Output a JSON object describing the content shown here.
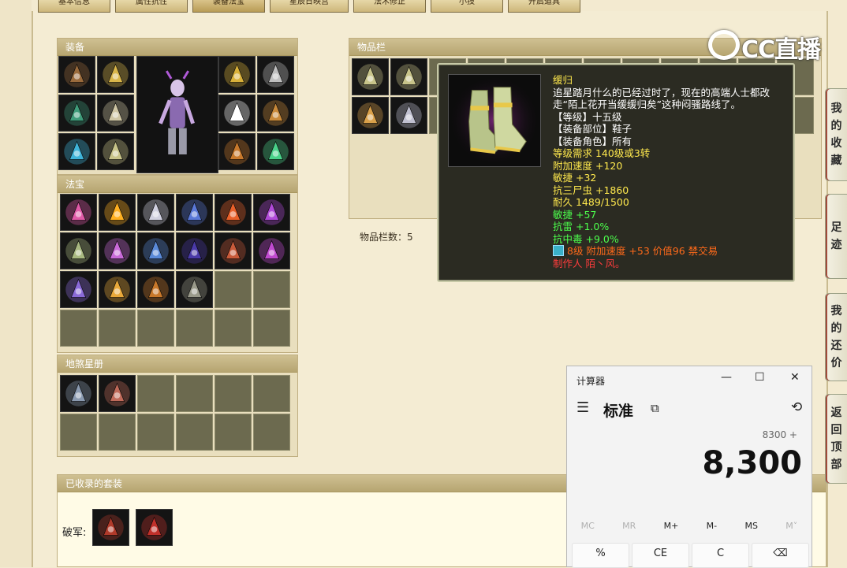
{
  "tabs": [
    "基本信息",
    "属性抗性",
    "装备法宝",
    "星辰日映宫",
    "法术修正",
    "小技",
    "开启道具"
  ],
  "equipment": {
    "title": "装备",
    "left_items": [
      {
        "icon": "hair-icon",
        "color": "#9a6b3c"
      },
      {
        "icon": "necklace-icon",
        "color": "#d9b64a"
      },
      {
        "icon": "spear-icon",
        "color": "#3f9c7a"
      },
      {
        "icon": "armor-icon",
        "color": "#cfc6a4"
      },
      {
        "icon": "charm-icon",
        "color": "#3fb4d9"
      },
      {
        "icon": "boots-icon",
        "color": "#c8c48a"
      }
    ],
    "right_items": [
      {
        "icon": "mask-icon",
        "color": "#d9b13a"
      },
      {
        "icon": "bead-necklace-icon",
        "color": "#bfbfbf"
      },
      {
        "icon": "helmet-icon",
        "color": "#ffffff"
      },
      {
        "icon": "ring-icon",
        "color": "#c98a3a"
      },
      {
        "icon": "ring-icon",
        "color": "#c8792c"
      },
      {
        "icon": "orb-icon",
        "color": "#4ad28a"
      }
    ]
  },
  "treasure": {
    "title": "法宝",
    "items": [
      {
        "icon": "lantern-icon",
        "color": "#e05aa8"
      },
      {
        "icon": "flame-icon",
        "color": "#ffb020"
      },
      {
        "icon": "mirror-icon",
        "color": "#d0d0e0"
      },
      {
        "icon": "gauntlet-icon",
        "color": "#5a78d8"
      },
      {
        "icon": "sword-icon",
        "color": "#e8602a"
      },
      {
        "icon": "claw-icon",
        "color": "#b04ad8"
      },
      {
        "icon": "jade-icon",
        "color": "#a8b880"
      },
      {
        "icon": "staff-icon",
        "color": "#c86ad8"
      },
      {
        "icon": "bracer-icon",
        "color": "#5a8ad8"
      },
      {
        "icon": "vortex-icon",
        "color": "#4a3aa8"
      },
      {
        "icon": "bell-icon",
        "color": "#c85a3a"
      },
      {
        "icon": "whip-icon",
        "color": "#c04ad0"
      },
      {
        "icon": "scroll-icon",
        "color": "#8a6ad8"
      },
      {
        "icon": "tower-icon",
        "color": "#e8a83a"
      },
      {
        "icon": "pipa-icon",
        "color": "#c8782a"
      },
      {
        "icon": "fan-icon",
        "color": "#9a9a8a"
      }
    ]
  },
  "stars": {
    "title": "地煞星册",
    "items": [
      {
        "icon": "card-warrior-icon",
        "color": "#8a9ab0"
      },
      {
        "icon": "card-warrior-icon",
        "color": "#c06a5a"
      }
    ]
  },
  "inventory": {
    "title": "物品栏",
    "count_label": "物品栏数：5",
    "items": [
      {
        "icon": "boots-icon",
        "color": "#c8c48a"
      },
      {
        "icon": "boots-icon",
        "color": "#c8c48a"
      },
      {
        "icon": "amulet-icon",
        "color": "#d9a04a"
      },
      {
        "icon": "tablet-icon",
        "color": "#c0c0d0"
      }
    ]
  },
  "tooltip": {
    "name": "缓归",
    "desc": "追星踏月什么的已经过时了，现在的高端人士都改走“陌上花开当缓缓归矣”这种闷骚路线了。",
    "level": "【等级】十五级",
    "slot": "【装备部位】鞋子",
    "role": "【装备角色】所有",
    "req": "等级需求 140级或3转",
    "speed": "附加速度 +120",
    "agility": "敏捷 +32",
    "resist_worm": "抗三尸虫 +1860",
    "durability": "耐久 1489/1500",
    "agility_bonus": "敏捷 +57",
    "resist_thunder": "抗雷 +1.0%",
    "resist_poison": "抗中毒 +9.0%",
    "gem": "8级 附加速度 +53 价值96 禁交易",
    "maker": "制作人 陌丶风。"
  },
  "suits": {
    "title": "已收录的套装",
    "label": "破军:",
    "items": [
      {
        "icon": "helmet-red-icon",
        "color": "#b03a2a"
      },
      {
        "icon": "necklace-red-icon",
        "color": "#c0302a"
      }
    ]
  },
  "logo": "CC直播",
  "calculator": {
    "title": "计算器",
    "minimize": "—",
    "maximize": "☐",
    "close": "✕",
    "menu": "☰",
    "mode": "标准",
    "keep_on_top": "⧉",
    "history": "⟲",
    "expression": "8300 +",
    "display": "8,300",
    "memory": [
      "MC",
      "MR",
      "M+",
      "M-",
      "MS",
      "M˅"
    ],
    "keys": [
      "%",
      "CE",
      "C",
      "⌫"
    ]
  },
  "sidebar": [
    {
      "label": "我的收藏",
      "chars": [
        "我",
        "的",
        "收",
        "藏"
      ]
    },
    {
      "label": "足迹",
      "chars": [
        "足",
        "迹"
      ]
    },
    {
      "label": "我的还价",
      "chars": [
        "我",
        "的",
        "还",
        "价"
      ]
    },
    {
      "label": "返回顶部",
      "chars": [
        "返",
        "回",
        "顶",
        "部"
      ]
    }
  ]
}
